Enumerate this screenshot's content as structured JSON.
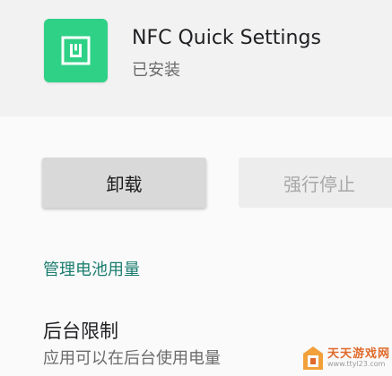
{
  "app": {
    "name": "NFC Quick Settings",
    "status": "已安装",
    "icon": "nfc-icon",
    "icon_color": "#2fd186"
  },
  "actions": {
    "uninstall_label": "卸载",
    "force_stop_label": "强行停止"
  },
  "battery": {
    "section_title": "管理电池用量",
    "background_limit_title": "后台限制",
    "background_limit_summary": "应用可以在后台使用电量"
  },
  "watermark": {
    "name": "天天游戏网",
    "url": "www.ttyl23.com"
  },
  "colors": {
    "accent": "#1b7d6f",
    "header_bg": "#f2f2f2",
    "disabled_text": "#a8a8a8"
  }
}
